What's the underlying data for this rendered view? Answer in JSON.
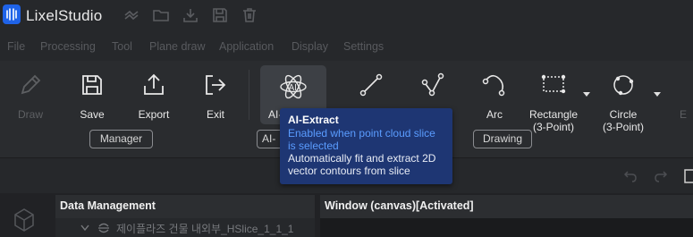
{
  "app": {
    "name": "LixelStudio"
  },
  "menu": [
    "File",
    "Processing",
    "Tool",
    "Plane draw",
    "Application",
    "Display",
    "Settings"
  ],
  "ribbon": {
    "draw": "Draw",
    "save": "Save",
    "export": "Export",
    "exit": "Exit",
    "ai_extract": "AI-E",
    "arc": "Arc",
    "rectangle": "Rectangle\n(3-Point)",
    "circle": "Circle\n(3-Point)",
    "more": "E",
    "groups": {
      "manager": "Manager",
      "ai": "AI-",
      "drawing": "Drawing"
    }
  },
  "tooltip": {
    "title": "AI-Extract",
    "note": "Enabled when point cloud slice is selected",
    "description": "Automatically fit and extract 2D vector contours from slice"
  },
  "panels": {
    "data_management": "Data Management",
    "window": "Window (canvas)[Activated]",
    "tree_item": "제이플라즈 건물 내외부_HSlice_1_1_1"
  },
  "colors": {
    "accent": "#1f63e8",
    "tooltip_bg": "#1e3673",
    "tooltip_note": "#5a9cff"
  }
}
